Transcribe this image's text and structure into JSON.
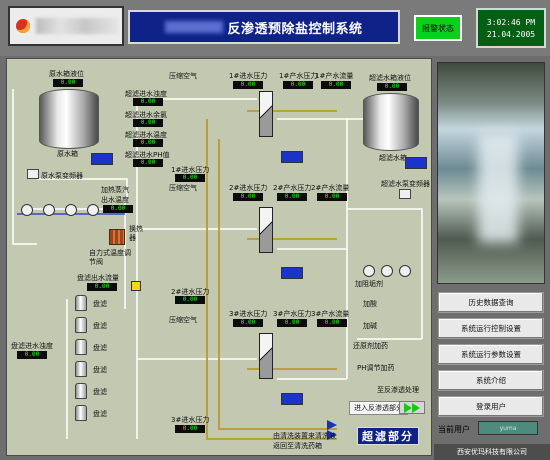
{
  "header": {
    "title": "反渗透预除盐控制系统",
    "alarm_button": "报警状态",
    "time": "3:02:46 PM",
    "date": "21.04.2005"
  },
  "process": {
    "raw_tank_level_label": "原水箱液位",
    "raw_tank_level_value": "0.00",
    "raw_tank_name": "原水箱",
    "raw_pump_label": "原水泵变频器",
    "inlet_turbidity_label": "超滤进水浊度",
    "inlet_turbidity_value": "0.00",
    "inlet_residual_cl_label": "超滤进水余氯",
    "inlet_residual_cl_value": "0.00",
    "inlet_temp_label": "超滤进水温度",
    "inlet_temp_value": "0.00",
    "inlet_ph_label": "超滤进水PH值",
    "inlet_ph_value": "0.00",
    "heater_label": "加热蒸汽",
    "outlet_temp_label": "出水温度",
    "outlet_temp_value": "0.00",
    "heat_exchanger_label": "换热器",
    "self_temp_label": "自力式温度调节阀",
    "filter_outlet_flow_label": "盘滤出水流量",
    "filter_outlet_flow_value": "0.00",
    "filter_label": "盘滤",
    "filter_turbidity_label": "盘滤进水浊度",
    "filter_turbidity_value": "0.00",
    "compressed_air_label": "压缩空气",
    "uf1_inlet_label": "1#进水压力",
    "uf1_inlet_value": "0.00",
    "uf1_produced_label": "1#产水压力",
    "uf1_produced_value": "0.00",
    "uf1_flow_label": "1#产水流量",
    "uf1_flow_value": "0.00",
    "uf1_bottom_label": "1#进水压力",
    "uf1_bottom_value": "0.00",
    "uf2_inlet_label": "2#进水压力",
    "uf2_inlet_value": "0.00",
    "uf2_produced_label": "2#产水压力",
    "uf2_produced_value": "0.00",
    "uf2_flow_label": "2#产水流量",
    "uf2_flow_value": "0.00",
    "uf2_bottom_label": "2#进水压力",
    "uf2_bottom_value": "0.00",
    "uf3_inlet_label": "3#进水压力",
    "uf3_inlet_value": "0.00",
    "uf3_produced_label": "3#产水压力",
    "uf3_produced_value": "0.00",
    "uf3_flow_label": "3#产水流量",
    "uf3_flow_value": "0.00",
    "uf3_bottom_label": "3#进水压力",
    "uf3_bottom_value": "0.00",
    "uf_tank_level_label": "超滤水箱液位",
    "uf_tank_level_value": "0.00",
    "uf_tank_name": "超滤水箱",
    "uf_pump_label": "超滤水泵变频器",
    "dose_scale_label": "加阻垢剂",
    "dose_acid_label": "加酸",
    "dose_base_label": "加碱",
    "dose_reductant_label": "还原剂加药",
    "ph_adjust_label": "PH调节加药",
    "to_ro_label": "至反渗透处理",
    "backwash_line1": "由清洗装置来清洗液",
    "backwash_line2": "返回至清洗药箱",
    "enter_ro_label": "进入反渗透部分",
    "section_tag": "超滤部分"
  },
  "sidebar": {
    "buttons": [
      "历史数据查询",
      "系统运行控制设置",
      "系统运行参数设置",
      "系统介绍",
      "登录用户"
    ],
    "user_label": "当前用户",
    "user_value": "yuma",
    "footer": "西安优玛科技有限公司"
  },
  "colors": {
    "title_bg": "#0f2287",
    "alarm_green": "#09d11b",
    "clock_bg": "#045f14",
    "panel_bg": "#c3c8b1",
    "readout_green": "#28ff28",
    "pipe_yellow": "#b7a13a"
  }
}
